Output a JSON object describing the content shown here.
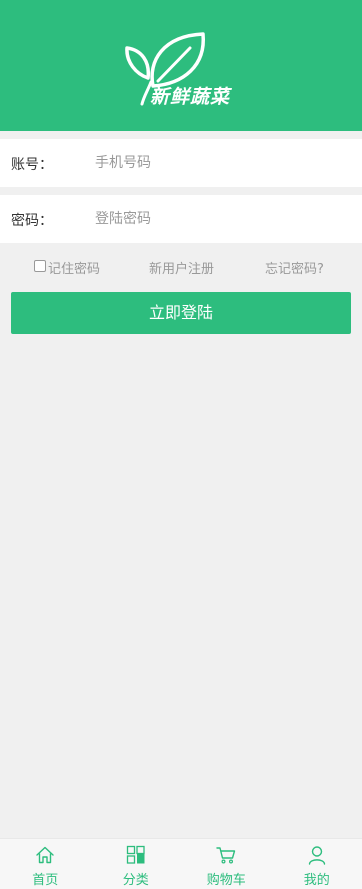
{
  "brand": {
    "name": "新鲜蔬菜"
  },
  "form": {
    "account": {
      "label": "账号：",
      "placeholder": "手机号码"
    },
    "password": {
      "label": "密码：",
      "placeholder": "登陆密码"
    }
  },
  "options": {
    "remember": "记住密码",
    "register": "新用户注册",
    "forgot": "忘记密码?"
  },
  "login_button": "立即登陆",
  "tabbar": {
    "items": [
      {
        "label": "首页",
        "icon": "home-icon"
      },
      {
        "label": "分类",
        "icon": "category-icon"
      },
      {
        "label": "购物车",
        "icon": "cart-icon"
      },
      {
        "label": "我的",
        "icon": "user-icon"
      }
    ]
  },
  "colors": {
    "primary": "#2dbd7e",
    "background": "#f0f0f0"
  }
}
